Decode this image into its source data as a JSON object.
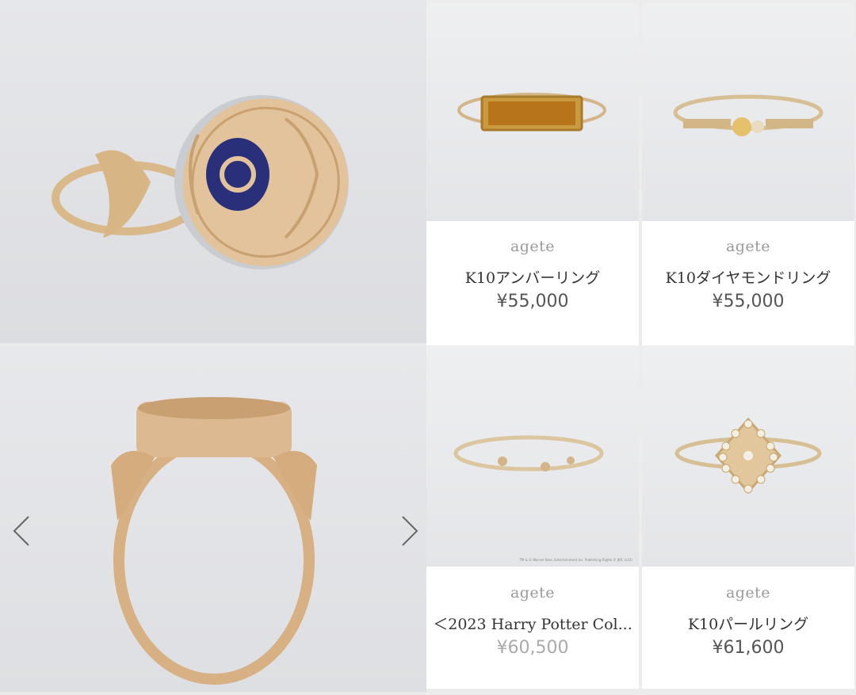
{
  "hero": {
    "images": [
      {
        "alt": "ring-angle-view"
      },
      {
        "alt": "ring-front-view"
      }
    ],
    "prev_icon": "chevron-left-icon",
    "next_icon": "chevron-right-icon"
  },
  "products": [
    {
      "brand": "agete",
      "name": "K10アンバーリング",
      "price": "¥55,000",
      "muted": false
    },
    {
      "brand": "agete",
      "name": "K10ダイヤモンドリング",
      "price": "¥55,000",
      "muted": false
    },
    {
      "brand": "agete",
      "name": "＜2023 Harry Potter Col...",
      "price": "¥60,500",
      "muted": true,
      "copyright": "TM & © Warner Bros. Entertainment Inc. Publishing Rights © JKR. (s23)"
    },
    {
      "brand": "agete",
      "name": "K10パールリング",
      "price": "¥61,600",
      "muted": false
    }
  ]
}
